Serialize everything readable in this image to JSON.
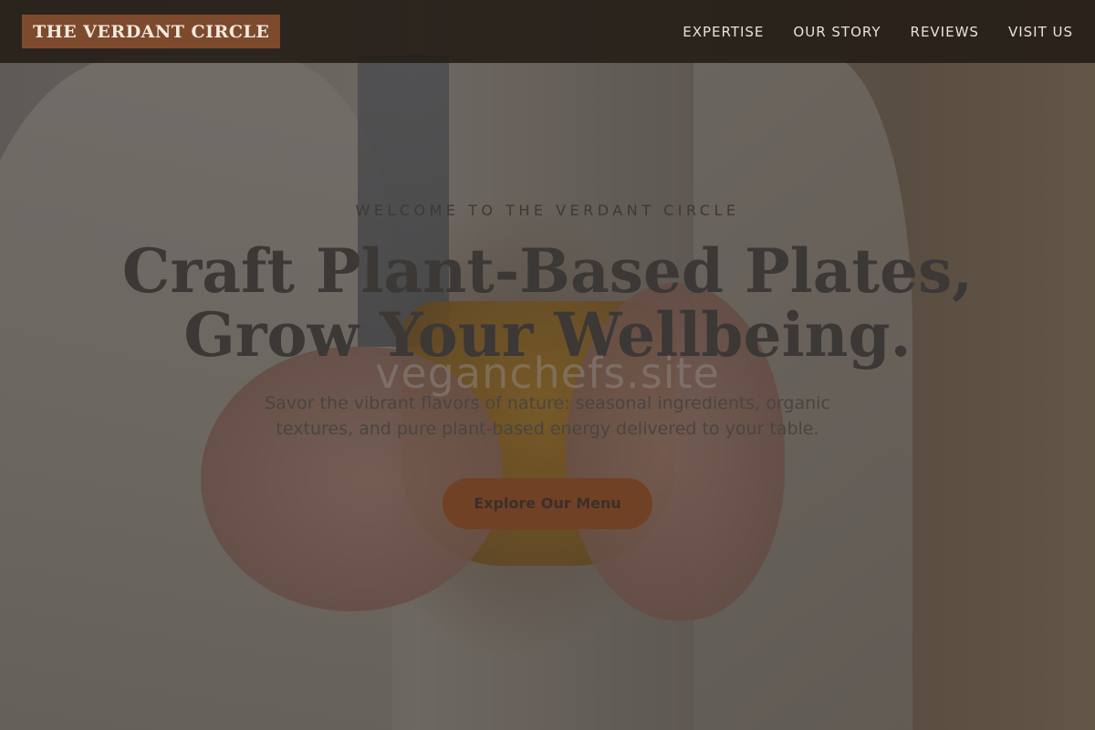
{
  "header": {
    "brand": "THE VERDANT CIRCLE",
    "nav": [
      {
        "label": "EXPERTISE"
      },
      {
        "label": "OUR STORY"
      },
      {
        "label": "REVIEWS"
      },
      {
        "label": "VISIT US"
      }
    ]
  },
  "hero": {
    "eyebrow": "WELCOME TO THE VERDANT CIRCLE",
    "headline_line1": "Craft Plant-Based Plates,",
    "headline_line2": "Grow Your Wellbeing.",
    "watermark": "veganchefs.site",
    "subtitle": "Savor the vibrant flavors of nature: seasonal ingredients, organic textures, and pure plant-based energy delivered to your table.",
    "cta_label": "Explore Our Menu"
  },
  "colors": {
    "brand_bg": "#7d4a2d",
    "header_bg": "#231c16",
    "cta_bg": "#714126",
    "headline_text": "#3b3836"
  }
}
